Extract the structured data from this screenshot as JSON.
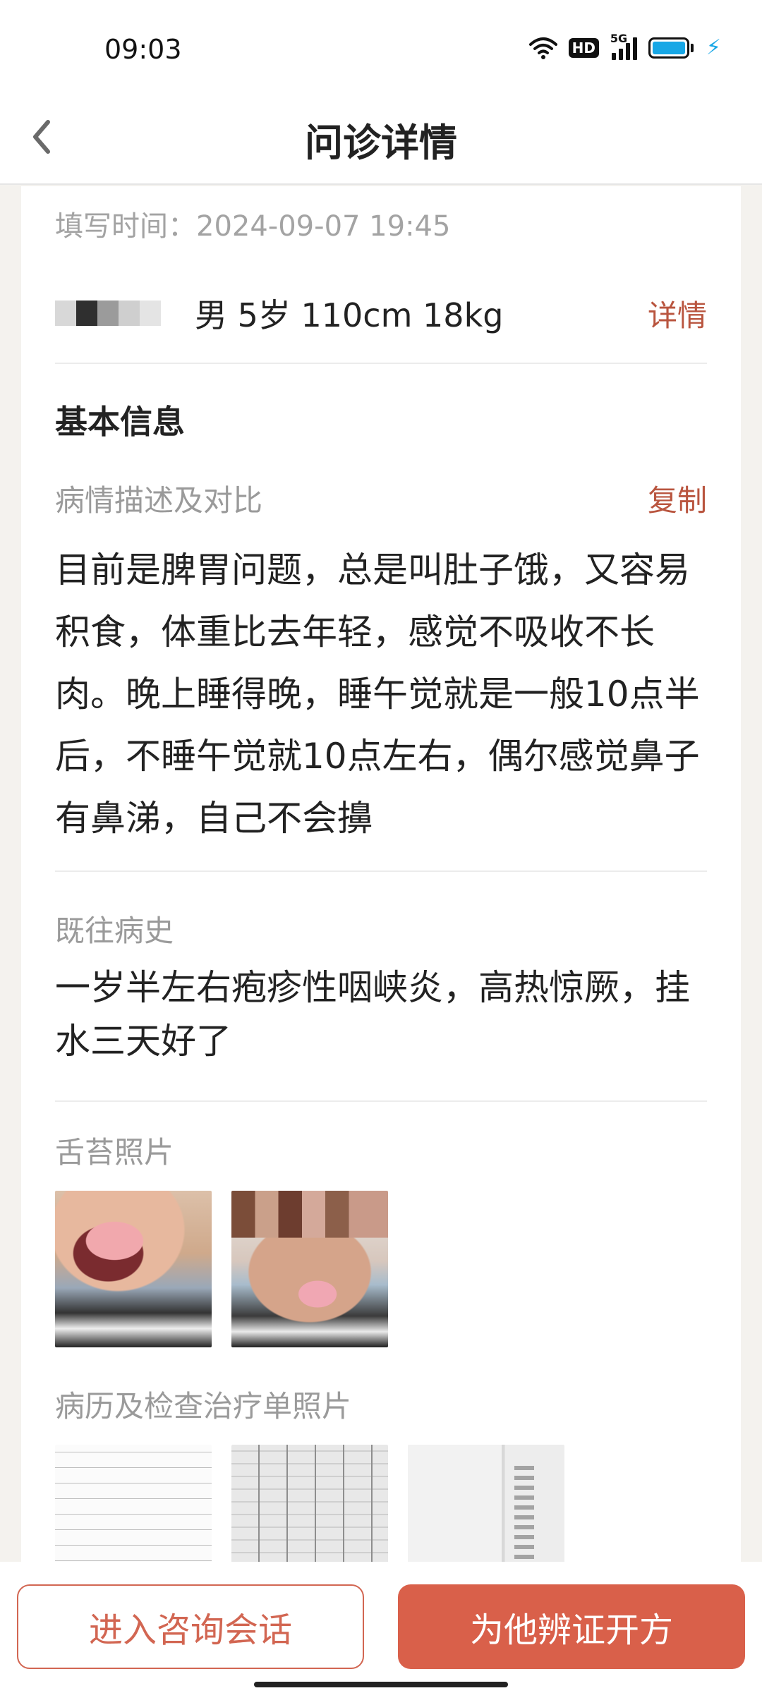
{
  "status_bar": {
    "time": "09:03",
    "hd": "HD",
    "network": "5G",
    "icons": [
      "wifi-icon",
      "hd-icon",
      "signal-icon",
      "battery-icon",
      "charging-icon"
    ],
    "battery_color": "#17a7e6"
  },
  "header": {
    "title": "问诊详情",
    "back_icon": "back-arrow-icon"
  },
  "record": {
    "fill_time_label": "填写时间：",
    "fill_time_value": "2024-09-07 19:45",
    "patient_info": "男 5岁 110cm 18kg",
    "detail_link": "详情"
  },
  "basic_info": {
    "title": "基本信息",
    "condition_label": "病情描述及对比",
    "copy_label": "复制",
    "condition_text": "目前是脾胃问题，总是叫肚子饿，又容易积食，体重比去年轻，感觉不吸收不长肉。晚上睡得晚，睡午觉就是一般10点半后，不睡午觉就10点左右，偶尔感觉鼻子有鼻涕，自己不会擤",
    "history_label": "既往病史",
    "history_text": "一岁半左右疱疹性咽峡炎，高热惊厥，挂水三天好了",
    "tongue_label": "舌苔照片",
    "records_label": "病历及检查治疗单照片"
  },
  "actions": {
    "consult_button": "进入咨询会话",
    "prescribe_button": "为他辨证开方"
  },
  "colors": {
    "accent": "#d9604a",
    "link": "#b9553f",
    "label_gray": "#9a9a9a"
  }
}
